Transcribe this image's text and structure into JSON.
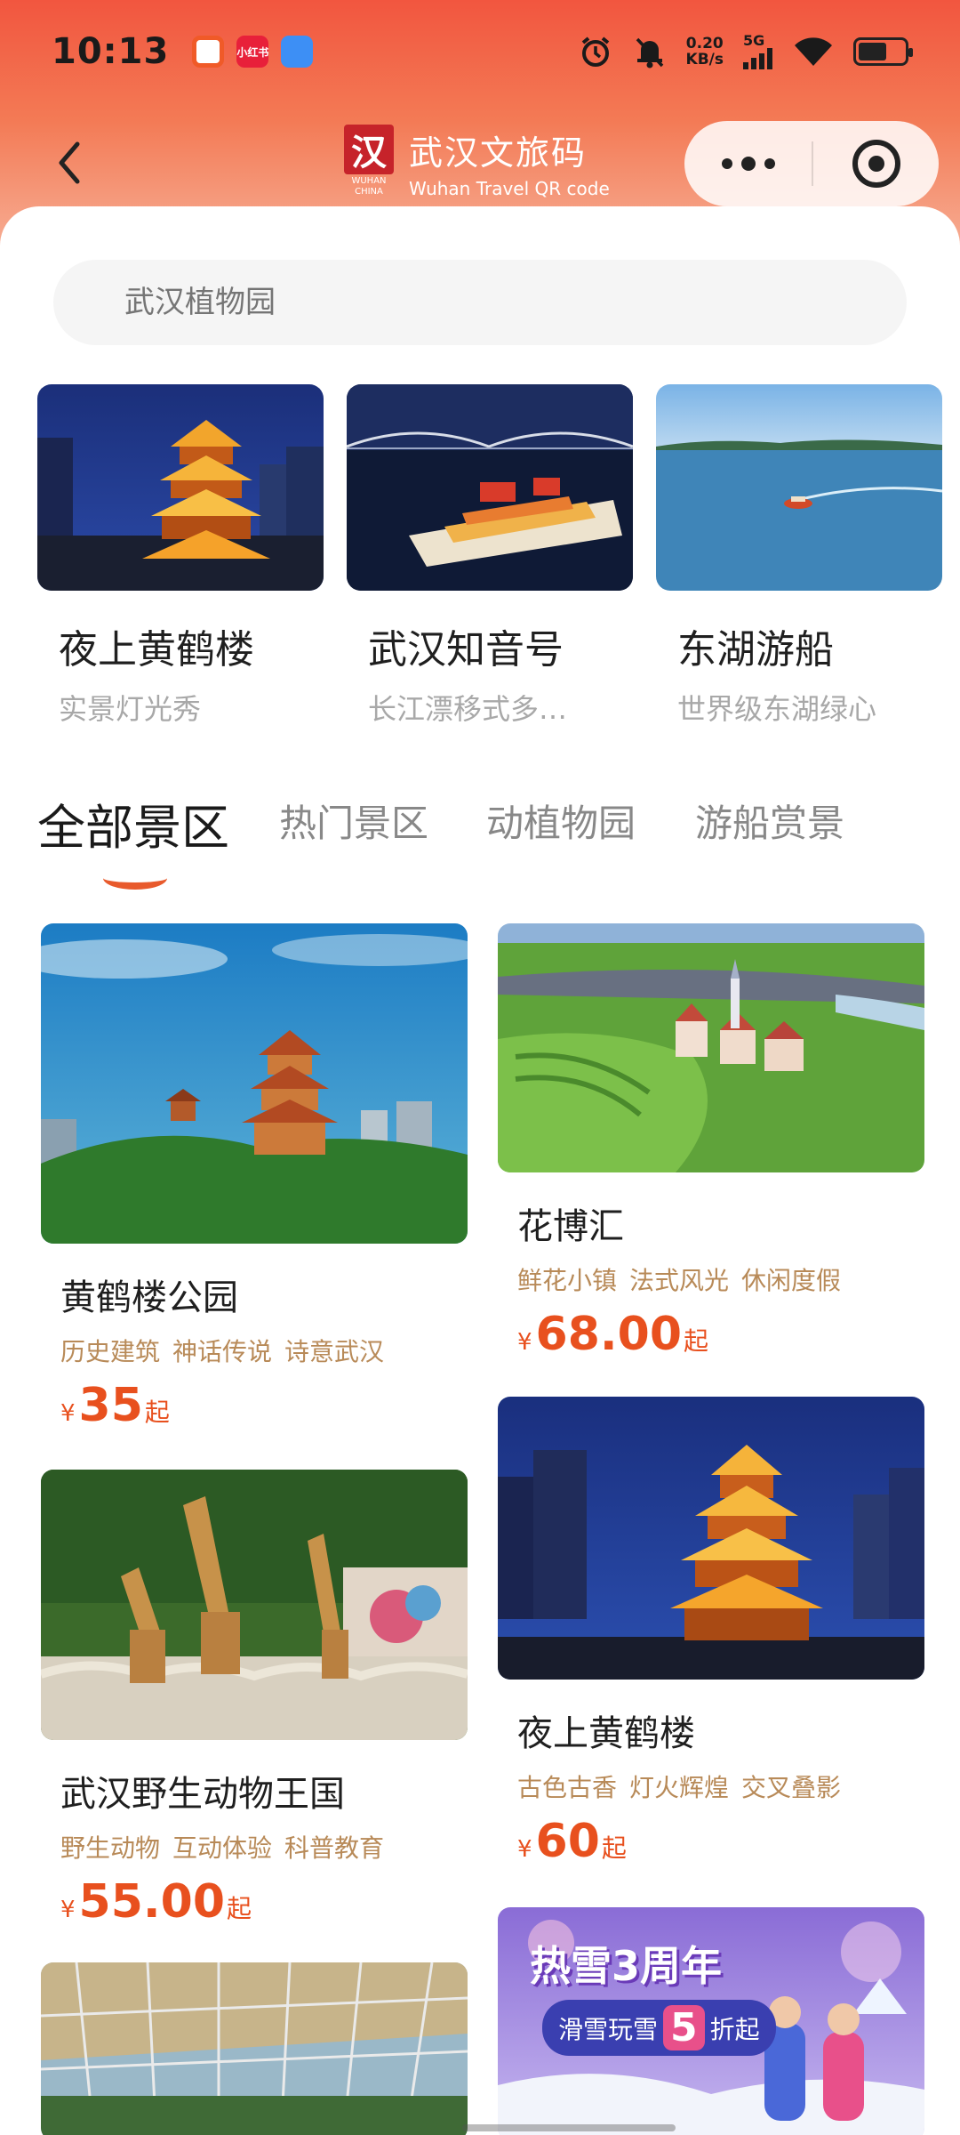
{
  "status_bar": {
    "time": "10:13",
    "net_speed_value": "0.20",
    "net_speed_unit": "KB/s",
    "network_type": "5G",
    "apps": [
      "taobao-app-icon",
      "xiaohongshu-app-icon",
      "browser-app-icon"
    ],
    "app_labels": [
      "",
      "小红书",
      ""
    ]
  },
  "nav": {
    "brand_seal": "汉",
    "brand_seal_sub": "WUHAN CHINA",
    "brand_name": "武汉文旅码",
    "brand_name_en": "Wuhan Travel QR code"
  },
  "search": {
    "placeholder": "武汉植物园"
  },
  "featured": [
    {
      "title": "夜上黄鹤楼",
      "subtitle": "实景灯光秀"
    },
    {
      "title": "武汉知音号",
      "subtitle": "长江漂移式多…"
    },
    {
      "title": "东湖游船",
      "subtitle": "世界级东湖绿心"
    }
  ],
  "tabs": [
    {
      "label": "全部景区",
      "active": true
    },
    {
      "label": "热门景区",
      "active": false
    },
    {
      "label": "动植物园",
      "active": false
    },
    {
      "label": "游船赏景",
      "active": false
    }
  ],
  "products": [
    {
      "title": "黄鹤楼公园",
      "tags": [
        "历史建筑",
        "神话传说",
        "诗意武汉"
      ],
      "currency": "¥",
      "price": "35",
      "suffix": "起"
    },
    {
      "title": "花博汇",
      "tags": [
        "鲜花小镇",
        "法式风光",
        "休闲度假"
      ],
      "currency": "¥",
      "price": "68.00",
      "suffix": "起"
    },
    {
      "title": "武汉野生动物王国",
      "tags": [
        "野生动物",
        "互动体验",
        "科普教育"
      ],
      "currency": "¥",
      "price": "55.00",
      "suffix": "起"
    },
    {
      "title": "夜上黄鹤楼",
      "tags": [
        "古色古香",
        "灯火辉煌",
        "交叉叠影"
      ],
      "currency": "¥",
      "price": "60",
      "suffix": "起"
    }
  ],
  "promo_banner": {
    "headline": "热雪3周年",
    "subline": "滑雪玩雪",
    "discount": "5",
    "discount_suffix": "折起"
  },
  "colors": {
    "header_top": "#f2563f",
    "accent": "#e8501e",
    "tag": "#b88a58"
  }
}
